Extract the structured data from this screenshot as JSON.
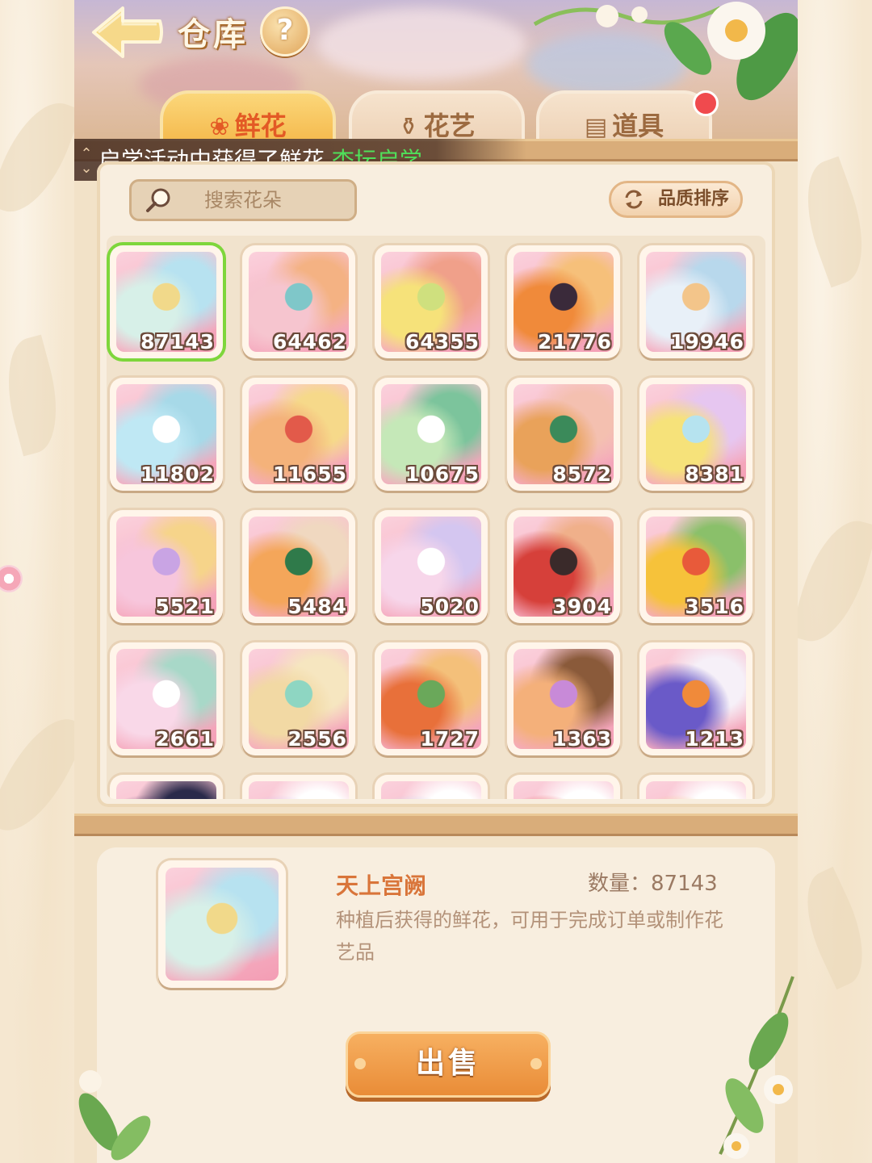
{
  "header": {
    "title": "仓库",
    "help_label": "?"
  },
  "tabs": [
    {
      "label": "鲜花",
      "icon": "rose-icon",
      "active": true
    },
    {
      "label": "花艺",
      "icon": "vase-icon",
      "active": false
    },
    {
      "label": "道具",
      "icon": "chest-icon",
      "active": false,
      "badge": true
    }
  ],
  "ticker": {
    "prefix": "启学活动中获得了鲜花 ",
    "highlight": "杏坛启学",
    "suffix": " 。"
  },
  "search": {
    "placeholder": "搜索花朵"
  },
  "sort": {
    "label": "品质排序"
  },
  "items": [
    {
      "count": "87143",
      "palette": [
        "#d7f0e8",
        "#f1d98a",
        "#b7e2f0"
      ]
    },
    {
      "count": "64462",
      "palette": [
        "#f6c5cf",
        "#7fc7c9",
        "#f4b283"
      ]
    },
    {
      "count": "64355",
      "palette": [
        "#f6e27a",
        "#cfe07e",
        "#f0a08a"
      ]
    },
    {
      "count": "21776",
      "palette": [
        "#f08a3a",
        "#3a2a3a",
        "#f6c07a"
      ]
    },
    {
      "count": "19946",
      "palette": [
        "#e8f0f8",
        "#f3c58a",
        "#b8d8ec"
      ]
    },
    {
      "count": "11802",
      "palette": [
        "#bfe8f4",
        "#ffffff",
        "#a7d9e8"
      ]
    },
    {
      "count": "11655",
      "palette": [
        "#f4b27a",
        "#e25a4a",
        "#f6d98a"
      ]
    },
    {
      "count": "10675",
      "palette": [
        "#c5e8b8",
        "#ffffff",
        "#7cc49c"
      ]
    },
    {
      "count": "8572",
      "palette": [
        "#e9a25a",
        "#3b8a5a",
        "#f4c0b0"
      ]
    },
    {
      "count": "8381",
      "palette": [
        "#f6e27a",
        "#b6e3ef",
        "#e6c6f0"
      ]
    },
    {
      "count": "5521",
      "palette": [
        "#f7c6dc",
        "#c9a4e4",
        "#f6d48a"
      ]
    },
    {
      "count": "5484",
      "palette": [
        "#f4a65a",
        "#2f7a4a",
        "#f0d8c0"
      ]
    },
    {
      "count": "5020",
      "palette": [
        "#f7d6ea",
        "#ffffff",
        "#d4c6f0"
      ]
    },
    {
      "count": "3904",
      "palette": [
        "#d6403a",
        "#3a2a2a",
        "#f0b08a"
      ]
    },
    {
      "count": "3516",
      "palette": [
        "#f6c23a",
        "#e85a3a",
        "#8ac06a"
      ]
    },
    {
      "count": "2661",
      "palette": [
        "#f9d8e8",
        "#ffffff",
        "#a8d8c8"
      ]
    },
    {
      "count": "2556",
      "palette": [
        "#f2d9a4",
        "#8ed6c2",
        "#f6e6c0"
      ]
    },
    {
      "count": "1727",
      "palette": [
        "#e8703a",
        "#6aa85a",
        "#f4c07a"
      ]
    },
    {
      "count": "1363",
      "palette": [
        "#f4b07a",
        "#c88ad8",
        "#8a5a3a"
      ]
    },
    {
      "count": "1213",
      "palette": [
        "#6a5ac8",
        "#f08a3a",
        "#f6f0f8"
      ]
    },
    {
      "count": "",
      "palette": [
        "#5a3a6a",
        "#f4b0a0",
        "#2a2a4a"
      ]
    },
    {
      "count": "",
      "palette": [
        "#d8c0f0",
        "#f6a0a0",
        "#ffffff"
      ]
    },
    {
      "count": "",
      "palette": [
        "#c8d8f0",
        "#f6c8d8",
        "#ffffff"
      ]
    },
    {
      "count": "",
      "palette": [
        "#e84a4a",
        "#f6a0c8",
        "#ffffff"
      ]
    },
    {
      "count": "",
      "palette": [
        "#f6d08a",
        "#f6a0c0",
        "#ffffff"
      ]
    }
  ],
  "detail": {
    "name": "天上宫阙",
    "quantity_label": "数量：87143",
    "description": "种植后获得的鲜花，可用于完成订单或制作花艺品",
    "sell_label": "出售"
  },
  "colors": {
    "accent": "#e98c37",
    "tab_active": "#f4b546",
    "selected_border": "#7ed63c",
    "highlight_text": "#4fe05a"
  }
}
